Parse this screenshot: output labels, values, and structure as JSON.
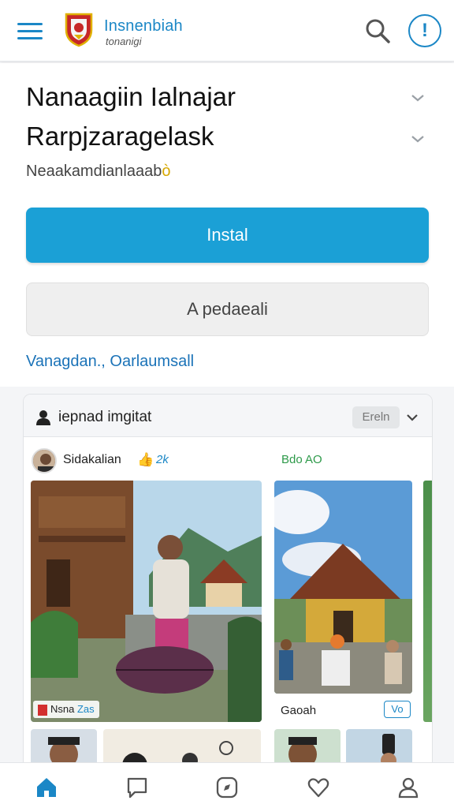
{
  "header": {
    "brand_title": "Insnenbiah",
    "brand_subtitle": "tonanigi",
    "colors": {
      "accent": "#1b87c6",
      "logo_red": "#c62828",
      "logo_gold": "#e0b000"
    }
  },
  "main": {
    "title_line1": "Nanaagiin Ialnajar",
    "title_line2": "Rarpjzaragelask",
    "subtitle": "Neaakamdianlaaab",
    "subtitle_highlight": "ò",
    "primary_button": "Instal",
    "secondary_button": "A pedaeali",
    "link_text": "Vanagdan., Oarlaumsall"
  },
  "card": {
    "header_title": "iepnad imgitat",
    "header_badge": "Ereln",
    "user_name": "Sidakalian",
    "like_count": "2k",
    "stat_text": "Bdo  AO",
    "photo1_tag": "Nsna",
    "photo1_tag_extra": "Zas",
    "photo2_caption": "Gaoah",
    "photo2_tag": "Vo"
  },
  "bottom_nav": {
    "items": [
      "home-icon",
      "chat-icon",
      "compass-icon",
      "heart-icon",
      "profile-icon"
    ]
  }
}
